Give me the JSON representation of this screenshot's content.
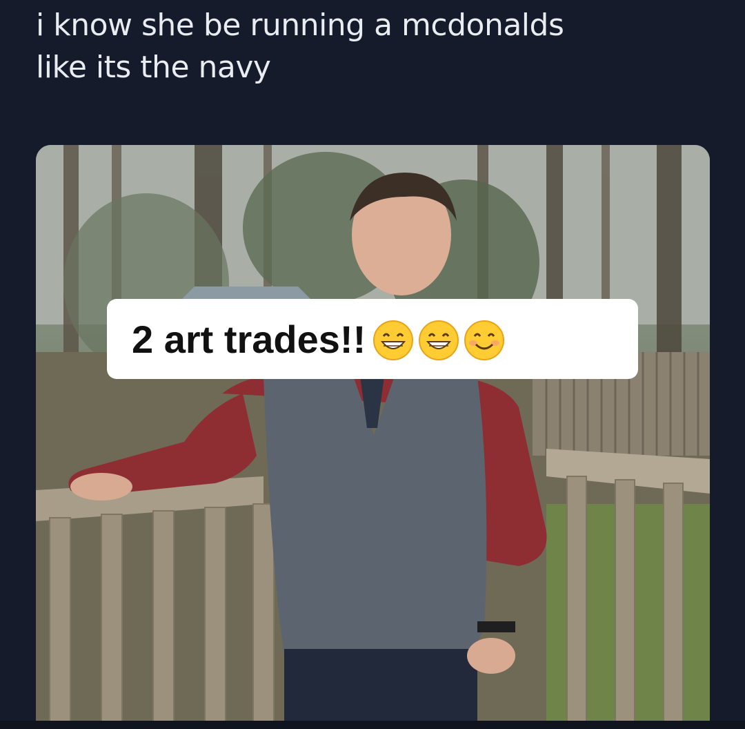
{
  "tweet": {
    "line1": "i know she be running a mcdonalds",
    "line2": "like its the navy"
  },
  "overlay": {
    "caption": "2 art trades!!",
    "emojis": [
      "grinning-face-icon",
      "grinning-face-icon",
      "smiling-face-icon"
    ]
  },
  "colors": {
    "background": "#151b2b",
    "text": "#e9ecf1",
    "sticker": "#ffffff",
    "emoji_yellow": "#ffcc33"
  }
}
